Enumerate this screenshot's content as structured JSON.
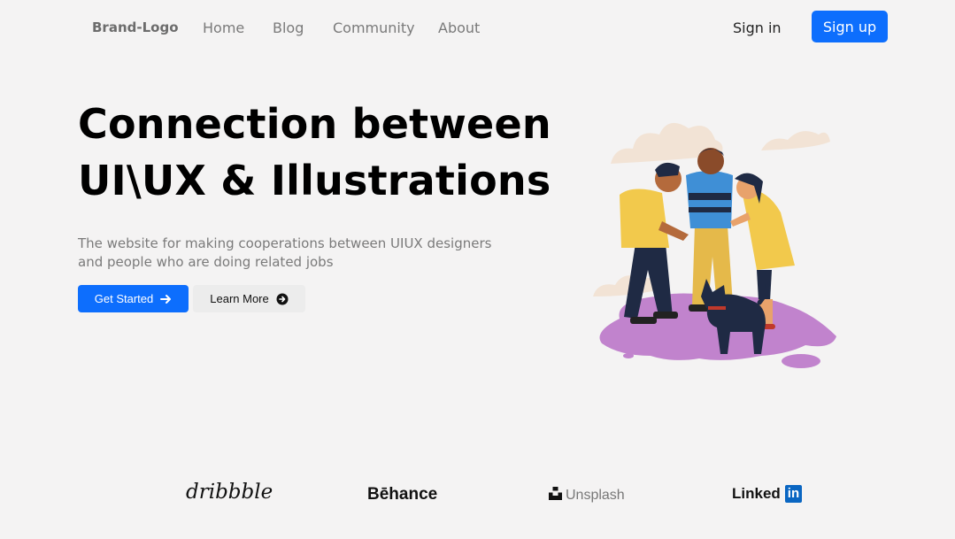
{
  "nav": {
    "brand": "Brand-Logo",
    "links": [
      "Home",
      "Blog",
      "Community",
      "About"
    ],
    "sign_in": "Sign in",
    "sign_up": "Sign up"
  },
  "hero": {
    "title_line1": "Connection between",
    "title_line2": "UI\\UX & Illustrations",
    "description": "The website for making cooperations between UIUX designers and people who are doing related jobs",
    "primary_button": "Get Started",
    "primary_icon": "arrow-right-icon",
    "secondary_button": "Learn More",
    "secondary_icon": "circle-arrow-right-icon"
  },
  "partners": {
    "dribbble": "dribbble",
    "behance": "Bēhance",
    "unsplash": "Unsplash",
    "linkedin_text": "Linked",
    "linkedin_box": "in"
  },
  "colors": {
    "accent": "#0d6efd",
    "background": "#f4f3f3",
    "muted_text": "#7a7a7a"
  }
}
